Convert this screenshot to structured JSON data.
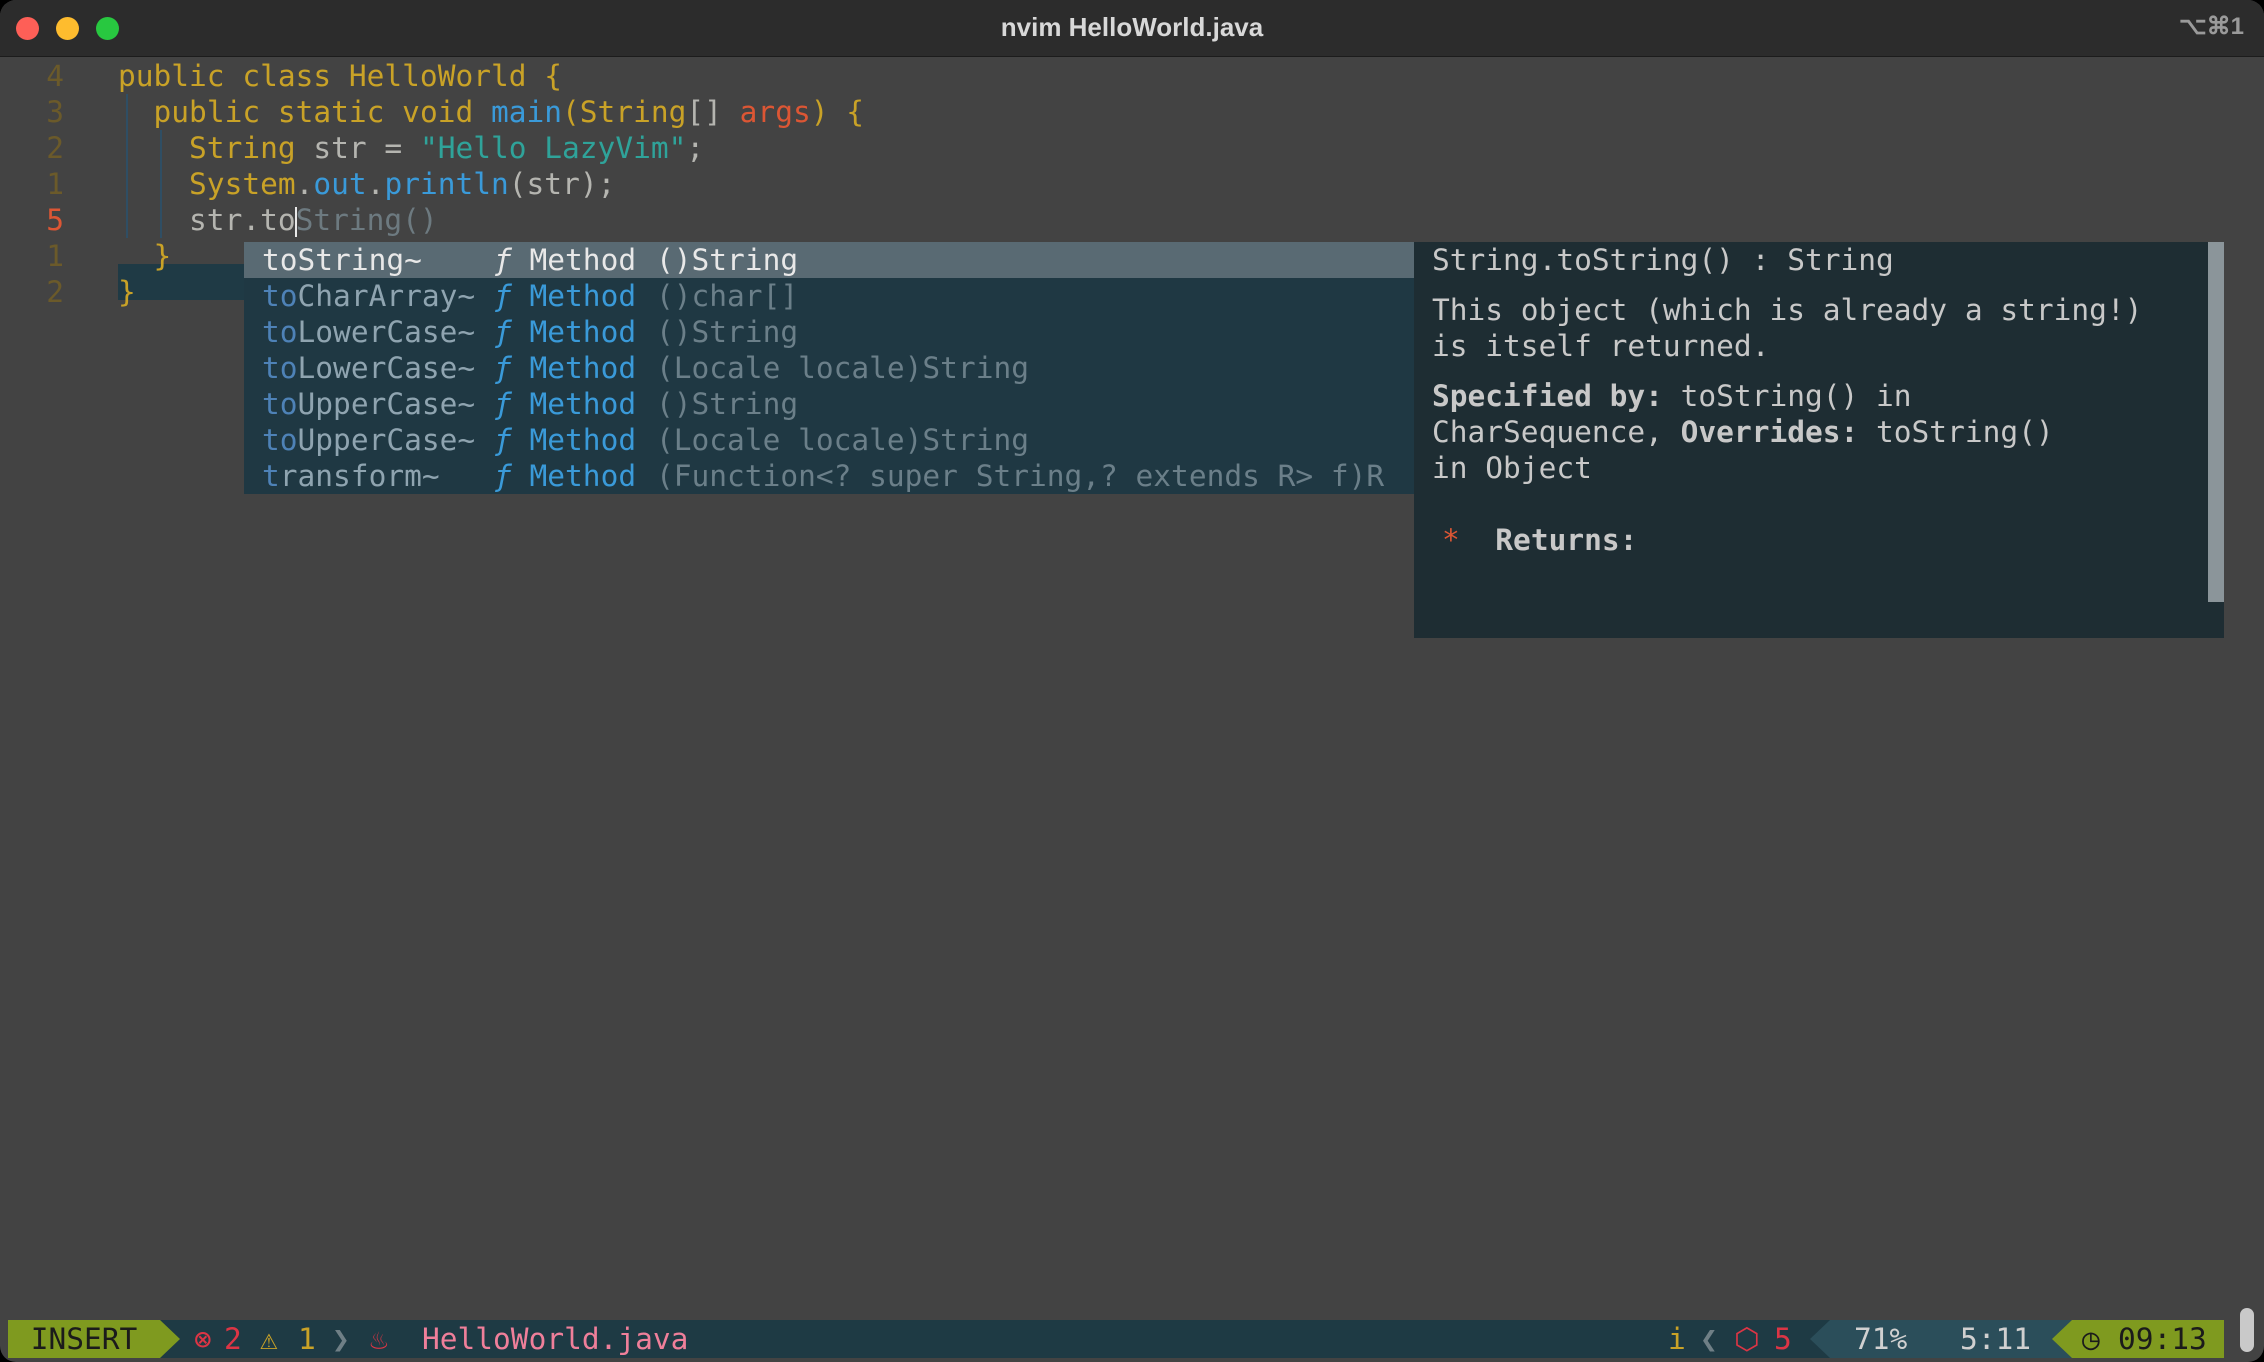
{
  "window": {
    "title": "nvim HelloWorld.java",
    "shortcut": "⌥⌘1"
  },
  "editor": {
    "lines": [
      {
        "num": "4",
        "current": false,
        "tokens": [
          {
            "t": "public class ",
            "c": "kw"
          },
          {
            "t": "HelloWorld",
            "c": "ty"
          },
          {
            "t": " {",
            "c": "kw"
          }
        ]
      },
      {
        "num": "3",
        "current": false,
        "tokens": [
          {
            "t": "  ",
            "c": "plain"
          },
          {
            "t": "public static void ",
            "c": "kw"
          },
          {
            "t": "main",
            "c": "fn"
          },
          {
            "t": "(",
            "c": "kw"
          },
          {
            "t": "String",
            "c": "ty"
          },
          {
            "t": "[] ",
            "c": "plain"
          },
          {
            "t": "args",
            "c": "par"
          },
          {
            "t": ") {",
            "c": "kw"
          }
        ]
      },
      {
        "num": "2",
        "current": false,
        "tokens": [
          {
            "t": "    ",
            "c": "plain"
          },
          {
            "t": "String",
            "c": "ty"
          },
          {
            "t": " str = ",
            "c": "plain"
          },
          {
            "t": "\"Hello LazyVim\"",
            "c": "str"
          },
          {
            "t": ";",
            "c": "plain"
          }
        ]
      },
      {
        "num": "1",
        "current": false,
        "tokens": [
          {
            "t": "    ",
            "c": "plain"
          },
          {
            "t": "System",
            "c": "ty"
          },
          {
            "t": ".",
            "c": "plain"
          },
          {
            "t": "out",
            "c": "fn"
          },
          {
            "t": ".",
            "c": "plain"
          },
          {
            "t": "println",
            "c": "fn"
          },
          {
            "t": "(str);",
            "c": "plain"
          }
        ]
      },
      {
        "num": "5",
        "current": true,
        "tokens": [
          {
            "t": "    str.to",
            "c": "plain"
          },
          {
            "t": "|",
            "c": "cursor"
          },
          {
            "t": "String()",
            "c": "ghost"
          }
        ]
      },
      {
        "num": "1",
        "current": false,
        "tokens": [
          {
            "t": "  }",
            "c": "kw"
          }
        ]
      },
      {
        "num": "2",
        "current": false,
        "tokens": [
          {
            "t": "}",
            "c": "kw"
          }
        ]
      }
    ]
  },
  "completion": {
    "items": [
      {
        "match": "to",
        "rest": "String~",
        "kind_icon": "ƒ",
        "kind": "Method",
        "signature": "()String",
        "selected": true
      },
      {
        "match": "to",
        "rest": "CharArray~",
        "kind_icon": "ƒ",
        "kind": "Method",
        "signature": "()char[]",
        "selected": false
      },
      {
        "match": "to",
        "rest": "LowerCase~",
        "kind_icon": "ƒ",
        "kind": "Method",
        "signature": "()String",
        "selected": false
      },
      {
        "match": "to",
        "rest": "LowerCase~",
        "kind_icon": "ƒ",
        "kind": "Method",
        "signature": "(Locale locale)String",
        "selected": false
      },
      {
        "match": "to",
        "rest": "UpperCase~",
        "kind_icon": "ƒ",
        "kind": "Method",
        "signature": "()String",
        "selected": false
      },
      {
        "match": "to",
        "rest": "UpperCase~",
        "kind_icon": "ƒ",
        "kind": "Method",
        "signature": "(Locale locale)String",
        "selected": false
      },
      {
        "match": "t",
        "rest": "ransform~",
        "kind_icon": "ƒ",
        "kind": "Method",
        "signature": "(Function<? super String,? extends R> f)R",
        "selected": false
      }
    ]
  },
  "doc": {
    "header": "String.toString() : String",
    "desc1": "This object (which is already a string!)",
    "desc2": "is itself returned.",
    "spec_label": "Specified by:",
    "spec_text": " toString() in",
    "over_prefix": "CharSequence, ",
    "over_label": "Overrides:",
    "over_text": " toString()",
    "in_object": "in Object",
    "star": "*",
    "returns": "Returns:"
  },
  "statusline": {
    "mode": "INSERT",
    "errors": "2",
    "warnings": "1",
    "filename": "HelloWorld.java",
    "info": "i",
    "packages": "5",
    "percent": "71%",
    "position": "5:11",
    "clock": "09:13"
  },
  "colors": {
    "background": "#434343",
    "keyword": "#c9a227",
    "function": "#3a9ad9",
    "string": "#2fa39a",
    "param": "#dc5634",
    "mode_bg": "#7f9a1f"
  }
}
